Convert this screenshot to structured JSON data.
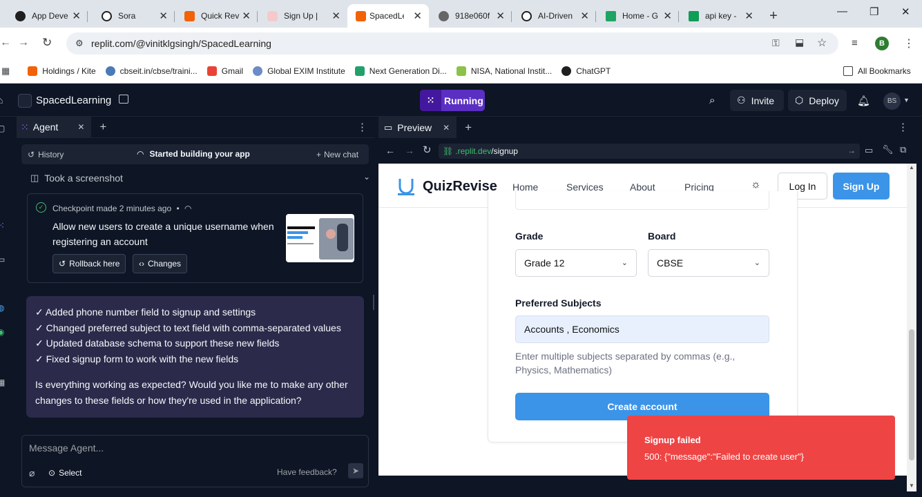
{
  "browser": {
    "tabs": [
      {
        "title": "App Deve",
        "color": "#1f1f1f"
      },
      {
        "title": "Sora",
        "color": "#1f1f1f"
      },
      {
        "title": "Quick Rev",
        "color": "#f26207"
      },
      {
        "title": "Sign Up |",
        "color": "#e9a0a0"
      },
      {
        "title": "SpacedLe",
        "color": "#f26207",
        "active": true
      },
      {
        "title": "918e060f",
        "color": "#666"
      },
      {
        "title": "AI-Driven",
        "color": "#1f1f1f"
      },
      {
        "title": "Home - G",
        "color": "#1fa463"
      },
      {
        "title": "api key -",
        "color": "#0f9d58"
      }
    ],
    "url": "replit.com/@vinitklgsingh/SpacedLearning",
    "profile_initial": "B",
    "bookmarks": [
      {
        "label": "Holdings / Kite",
        "color": "#f26207"
      },
      {
        "label": "cbseit.in/cbse/traini...",
        "color": "#4a7bb7"
      },
      {
        "label": "Gmail",
        "color": "#ea4335"
      },
      {
        "label": "Global EXIM Institute",
        "color": "#6b8cc7"
      },
      {
        "label": "Next Generation Di...",
        "color": "#22a06b"
      },
      {
        "label": "NISA, National Instit...",
        "color": "#8bc34a"
      },
      {
        "label": "ChatGPT",
        "color": "#1f1f1f"
      }
    ],
    "all_bookmarks": "All Bookmarks"
  },
  "replit": {
    "project_name": "SpacedLearning",
    "run_status": "Running",
    "invite": "Invite",
    "deploy": "Deploy",
    "avatar": "BS"
  },
  "agent": {
    "tab_label": "Agent",
    "history": "History",
    "status": "Started building your app",
    "new_chat": "New chat",
    "screenshot_note": "Took a screenshot",
    "checkpoint_prefix": "Checkpoint made",
    "checkpoint_time": "2 minutes ago",
    "checkpoint_bullet": "•",
    "checkpoint_desc": "Allow new users to create a unique username when registering an account",
    "rollback": "Rollback here",
    "changes": "Changes",
    "message_lines": [
      "✓ Added phone number field to signup and settings",
      "✓ Changed preferred subject to text field with comma-separated values",
      "✓ Updated database schema to support these new fields",
      "✓ Fixed signup form to work with the new fields"
    ],
    "message_question": "Is everything working as expected? Would you like me to make any other changes to these fields or how they're used in the application?",
    "input_placeholder": "Message Agent...",
    "select": "Select",
    "feedback": "Have feedback?"
  },
  "preview": {
    "tab_label": "Preview",
    "url_domain": ".replit.dev",
    "url_path": "/signup",
    "site": {
      "brand": "QuizRevise",
      "nav": [
        "Home",
        "Services",
        "About",
        "Pricing"
      ],
      "login": "Log In",
      "signup": "Sign Up",
      "grade_label": "Grade",
      "grade_value": "Grade 12",
      "board_label": "Board",
      "board_value": "CBSE",
      "subjects_label": "Preferred Subjects",
      "subjects_value": "Accounts , Economics",
      "subjects_help": "Enter multiple subjects separated by commas (e.g., Physics, Mathematics)",
      "submit": "Create account",
      "accent": "#3b94e8"
    },
    "toast": {
      "title": "Signup failed",
      "message": "500: {\"message\":\"Failed to create user\"}",
      "color": "#ef4444"
    }
  }
}
